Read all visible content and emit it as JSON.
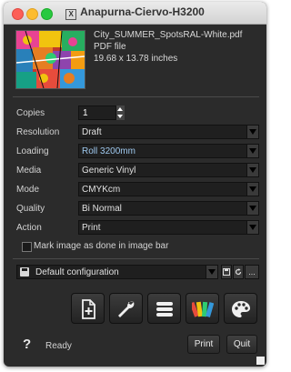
{
  "window": {
    "title": "Anapurna-Ciervo-H3200"
  },
  "file": {
    "name": "City_SUMMER_SpotsRAL-White.pdf",
    "type": "PDF file",
    "size": "19.68 x 13.78 inches"
  },
  "settings": {
    "copies": {
      "label": "Copies",
      "value": "1"
    },
    "resolution": {
      "label": "Resolution",
      "value": "Draft"
    },
    "loading": {
      "label": "Loading",
      "value": "Roll 3200mm"
    },
    "media": {
      "label": "Media",
      "value": "Generic Vinyl"
    },
    "mode": {
      "label": "Mode",
      "value": "CMYKcm"
    },
    "quality": {
      "label": "Quality",
      "value": "Bi Normal"
    },
    "action": {
      "label": "Action",
      "value": "Print"
    }
  },
  "mark_image": {
    "label": "Mark image as done in image bar",
    "checked": false
  },
  "configuration": {
    "value": "Default configuration",
    "more": "..."
  },
  "toolbar": {
    "icons": [
      "add-page-icon",
      "wrench-icon",
      "list-icon",
      "swatch-fan-icon",
      "palette-icon"
    ]
  },
  "footer": {
    "help": "?",
    "status": "Ready",
    "print_label": "Print",
    "quit_label": "Quit"
  },
  "colors": {
    "window_bg": "#2b2b2b",
    "field_bg": "#1f1f1f",
    "accent_text": "#9ec8ee"
  }
}
